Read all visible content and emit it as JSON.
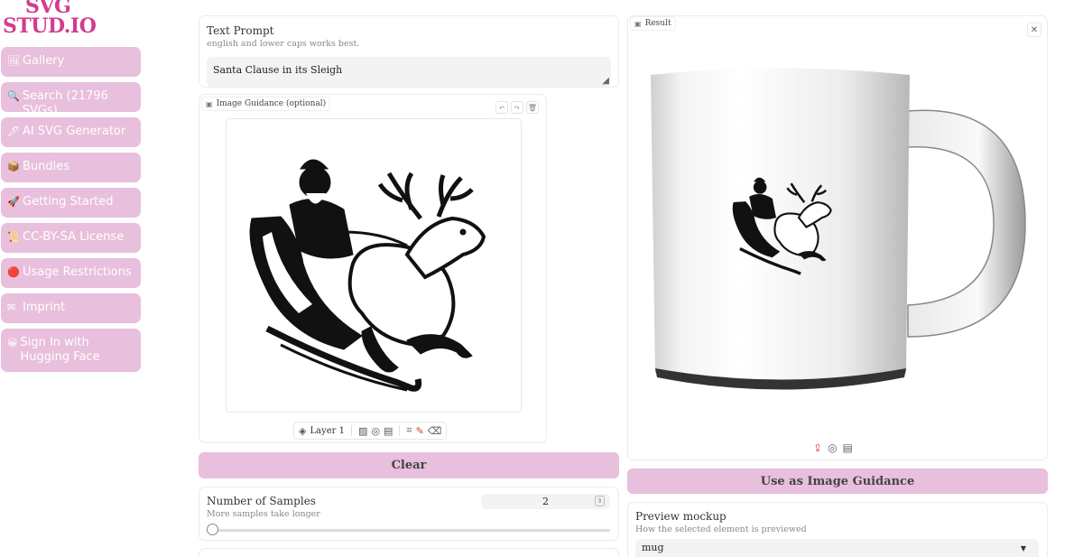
{
  "logo": {
    "line1": "SVG",
    "line2": "STUD.IO"
  },
  "sidebar": {
    "items": [
      {
        "icon": "🖼",
        "label": "Gallery"
      },
      {
        "icon": "🔍",
        "label": "Search (21796 SVGs)"
      },
      {
        "icon": "🖊",
        "label": "AI SVG Generator"
      },
      {
        "icon": "📦",
        "label": "Bundles"
      },
      {
        "icon": "🚀",
        "label": "Getting Started"
      },
      {
        "icon": "📜",
        "label": "CC-BY-SA License"
      },
      {
        "icon": "🔴",
        "label": "Usage Restrictions"
      },
      {
        "icon": "✉",
        "label": "Imprint"
      },
      {
        "icon": "😀",
        "label": "Sign In with Hugging Face"
      }
    ]
  },
  "prompt": {
    "label": "Text Prompt",
    "hint": "english and lower caps works best.",
    "value": "Santa Clause in its Sleigh"
  },
  "image_guidance": {
    "label": "Image Guidance (optional)",
    "layer_label": "Layer 1"
  },
  "clear_label": "Clear",
  "samples": {
    "label": "Number of Samples",
    "hint": "More samples take longer",
    "value": "2",
    "slider_fraction": 0.0
  },
  "result": {
    "label": "Result"
  },
  "use_guidance_label": "Use as Image Guidance",
  "preview": {
    "label": "Preview mockup",
    "hint": "How the selected element is previewed",
    "value": "mug"
  },
  "colors": {
    "accent": "#e8bfdc",
    "logo": "#d23c8e",
    "upload": "#d3452f"
  }
}
